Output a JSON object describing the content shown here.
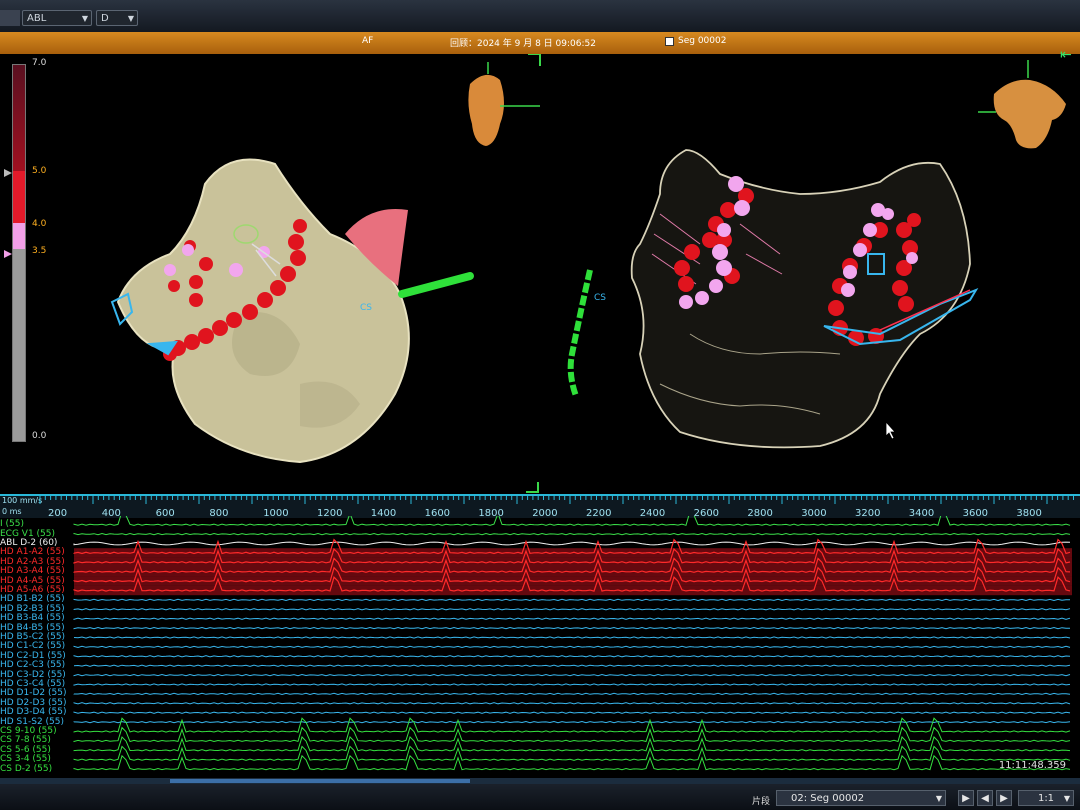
{
  "toolbar": {
    "map_select": "ABL",
    "view_select": "D"
  },
  "status": {
    "mode": "AF",
    "datetime": "回顾：2024 年 9 月 8 日 09:06:52",
    "segment": "Seg 00002"
  },
  "color_scale": {
    "max": "7.0",
    "upper": "5.0",
    "mid": "4.0",
    "lower": "3.5",
    "min": "0.0"
  },
  "map_labels": {
    "left_cs": "CS",
    "center_cs": "CS"
  },
  "timeline": {
    "scale_label": "100 mm/s",
    "unit_label": "0 ms",
    "ticks": [
      "200",
      "400",
      "600",
      "800",
      "1000",
      "1200",
      "1400",
      "1600",
      "1800",
      "2000",
      "2200",
      "2400",
      "2600",
      "2800",
      "3000",
      "3200",
      "3400",
      "3600",
      "3800"
    ]
  },
  "traces": [
    {
      "ch": "",
      "name": "I (55)"
    },
    {
      "ch": "ECG",
      "name": "V1 (55)"
    },
    {
      "ch": "ABL",
      "name": "D-2 (60)"
    },
    {
      "ch": "HD",
      "name": "A1-A2 (55)"
    },
    {
      "ch": "HD",
      "name": "A2-A3 (55)"
    },
    {
      "ch": "HD",
      "name": "A3-A4 (55)"
    },
    {
      "ch": "HD",
      "name": "A4-A5 (55)"
    },
    {
      "ch": "HD",
      "name": "A5-A6 (55)"
    },
    {
      "ch": "HD",
      "name": "B1-B2 (55)"
    },
    {
      "ch": "HD",
      "name": "B2-B3 (55)"
    },
    {
      "ch": "HD",
      "name": "B3-B4 (55)"
    },
    {
      "ch": "HD",
      "name": "B4-B5 (55)"
    },
    {
      "ch": "HD",
      "name": "B5-C2 (55)"
    },
    {
      "ch": "HD",
      "name": "C1-C2 (55)"
    },
    {
      "ch": "HD",
      "name": "C2-D1 (55)"
    },
    {
      "ch": "HD",
      "name": "C2-C3 (55)"
    },
    {
      "ch": "HD",
      "name": "C3-D2 (55)"
    },
    {
      "ch": "HD",
      "name": "C3-C4 (55)"
    },
    {
      "ch": "HD",
      "name": "D1-D2 (55)"
    },
    {
      "ch": "HD",
      "name": "D2-D3 (55)"
    },
    {
      "ch": "HD",
      "name": "D3-D4 (55)"
    },
    {
      "ch": "HD",
      "name": "S1-S2 (55)"
    },
    {
      "ch": "CS",
      "name": "9-10 (55)"
    },
    {
      "ch": "CS",
      "name": "7-8 (55)"
    },
    {
      "ch": "CS",
      "name": "5-6 (55)"
    },
    {
      "ch": "CS",
      "name": "3-4 (55)"
    },
    {
      "ch": "CS",
      "name": "D-2 (55)"
    }
  ],
  "clock": "11:11:48.359",
  "bottom": {
    "segment_label": "片段",
    "segment_value": "02: Seg 00002",
    "speed": "1:1"
  },
  "colors": {
    "ecg": "#3be04a",
    "abl": "#f0f0f0",
    "hd_a": "#ff2a2a",
    "hd_b": "#39b7ee",
    "cs": "#35e040",
    "accent": "#d78a20"
  }
}
